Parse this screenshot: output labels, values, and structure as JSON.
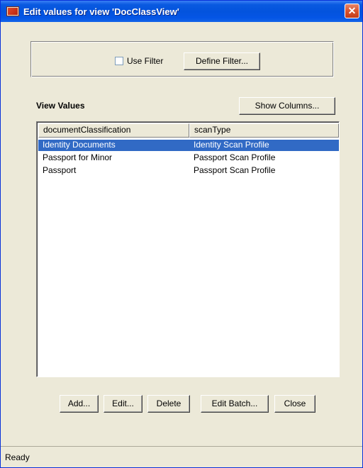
{
  "window": {
    "title": "Edit values for view 'DocClassView'",
    "close_glyph": "✕"
  },
  "filter": {
    "use_filter_label": "Use Filter",
    "use_filter_checked": false,
    "define_filter_label": "Define Filter..."
  },
  "view_values": {
    "label": "View Values",
    "show_columns_label": "Show Columns..."
  },
  "table": {
    "columns": [
      "documentClassification",
      "scanType"
    ],
    "rows": [
      {
        "documentClassification": "Identity Documents",
        "scanType": "Identity Scan Profile",
        "selected": true
      },
      {
        "documentClassification": "Passport for Minor",
        "scanType": "Passport Scan Profile",
        "selected": false
      },
      {
        "documentClassification": "Passport",
        "scanType": "Passport Scan Profile",
        "selected": false
      }
    ]
  },
  "actions": {
    "add_label": "Add...",
    "edit_label": "Edit...",
    "delete_label": "Delete",
    "edit_batch_label": "Edit Batch...",
    "close_label": "Close"
  },
  "status": {
    "text": "Ready"
  },
  "colors": {
    "titlebar": "#0353dd",
    "selection": "#316ac5",
    "dialog_bg": "#ece9d8"
  },
  "icons": [
    "app-icon",
    "close-icon",
    "checkbox-icon"
  ]
}
